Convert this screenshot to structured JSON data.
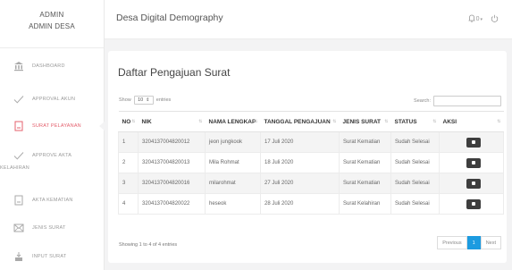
{
  "sidebar": {
    "role": "ADMIN",
    "name": "ADMIN DESA",
    "items": [
      {
        "label": "DASHBOARD",
        "icon": "bank-icon"
      },
      {
        "label": "APPROVAL AKUN",
        "icon": "check-icon"
      },
      {
        "label": "SURAT PELAYANAN",
        "icon": "document-icon"
      },
      {
        "label": "APPROVE AKTA",
        "label2": "KELAHIRAN",
        "icon": "check-icon"
      },
      {
        "label": "AKTA KEMATIAN",
        "icon": "document-icon"
      },
      {
        "label": "JENIS SURAT",
        "icon": "mail-icon"
      },
      {
        "label": "INPUT SURAT",
        "icon": "inbox-icon"
      }
    ]
  },
  "header": {
    "title": "Desa Digital Demography",
    "notif_count": "0"
  },
  "main": {
    "title": "Daftar Pengajuan Surat",
    "show_label": "Show",
    "entries_value": "10",
    "entries_label": "entries",
    "search_label": "Search:",
    "columns": [
      "NO",
      "NIK",
      "NAMA LENGKAP",
      "TANGGAL PENGAJUAN",
      "JENIS SURAT",
      "STATUS",
      "AKSI"
    ],
    "rows": [
      [
        "1",
        "3204137004820012",
        "jeon jungkook",
        "17 Juli 2020",
        "Surat Kematian",
        "Sudah Selesai"
      ],
      [
        "2",
        "3204137004820013",
        "Mila Rohmat",
        "18 Juli 2020",
        "Surat Kematian",
        "Sudah Selesai"
      ],
      [
        "3",
        "3204137004820016",
        "milarohmat",
        "27 Juli 2020",
        "Surat Kematian",
        "Sudah Selesai"
      ],
      [
        "4",
        "3204137004820022",
        "heseok",
        "28 Juli 2020",
        "Surat Kelahiran",
        "Sudah Selesai"
      ]
    ],
    "info": "Showing 1 to 4 of 4 entries",
    "pagination": {
      "previous": "Previous",
      "current": "1",
      "next": "Next"
    }
  },
  "colors": {
    "active": "#e4606d",
    "primary": "#1c9be0",
    "action_button": "#3e3e3e"
  }
}
